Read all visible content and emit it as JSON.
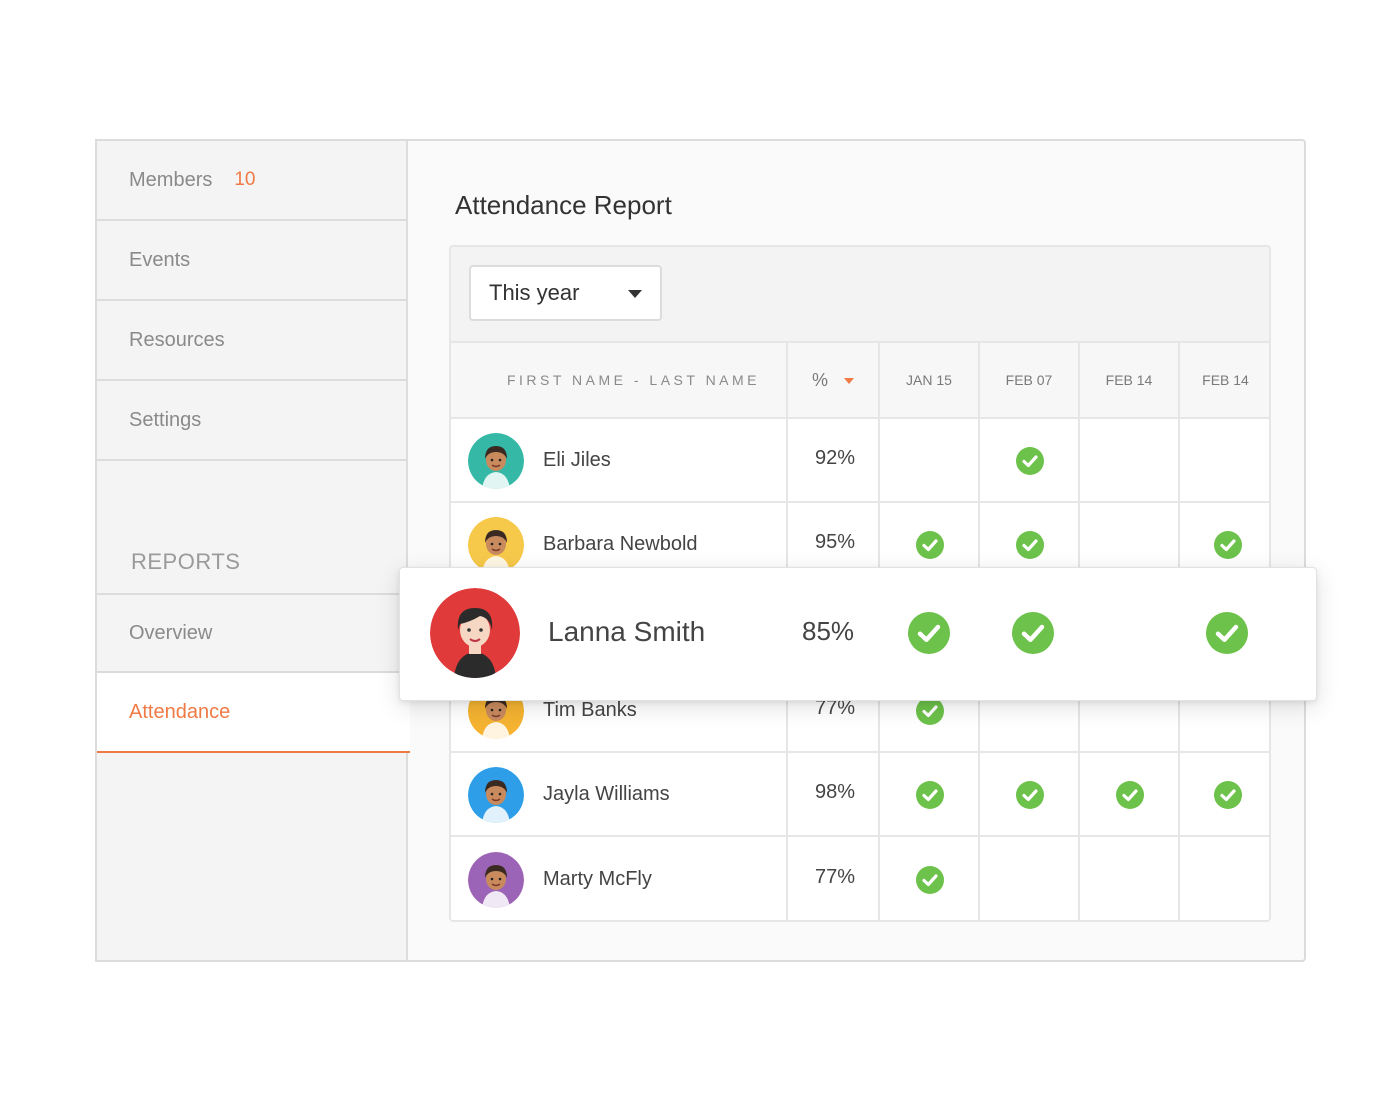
{
  "sidebar": {
    "members": {
      "label": "Members",
      "count": "10"
    },
    "events": "Events",
    "resources": "Resources",
    "settings": "Settings",
    "reports_section": "REPORTS",
    "overview": "Overview",
    "attendance": "Attendance"
  },
  "main": {
    "title": "Attendance Report",
    "filter": {
      "selected": "This year"
    },
    "columns": {
      "name": "FIRST NAME - LAST NAME",
      "pct": "%",
      "dates": [
        "JAN 15",
        "FEB 07",
        "FEB 14",
        "FEB 14"
      ]
    },
    "rows": [
      {
        "name": "Eli Jiles",
        "pct": "92%",
        "attended": [
          false,
          true,
          false,
          false
        ],
        "avatar_color": "#35b8a6"
      },
      {
        "name": "Barbara Newbold",
        "pct": "95%",
        "attended": [
          true,
          true,
          false,
          true
        ],
        "avatar_color": "#f7c94a"
      },
      {
        "name": "Tim Banks",
        "pct": "77%",
        "attended": [
          true,
          false,
          false,
          false
        ],
        "avatar_color": "#f5b331"
      },
      {
        "name": "Jayla Williams",
        "pct": "98%",
        "attended": [
          true,
          true,
          true,
          true
        ],
        "avatar_color": "#2e9ee8"
      },
      {
        "name": "Marty McFly",
        "pct": "77%",
        "attended": [
          true,
          false,
          false,
          false
        ],
        "avatar_color": "#9b64b7"
      }
    ],
    "highlight": {
      "name": "Lanna Smith",
      "pct": "85%",
      "attended": [
        true,
        true,
        false,
        true
      ],
      "avatar_color": "#e03a3a"
    }
  },
  "colors": {
    "accent": "#f07a45",
    "check": "#6cc24a"
  }
}
